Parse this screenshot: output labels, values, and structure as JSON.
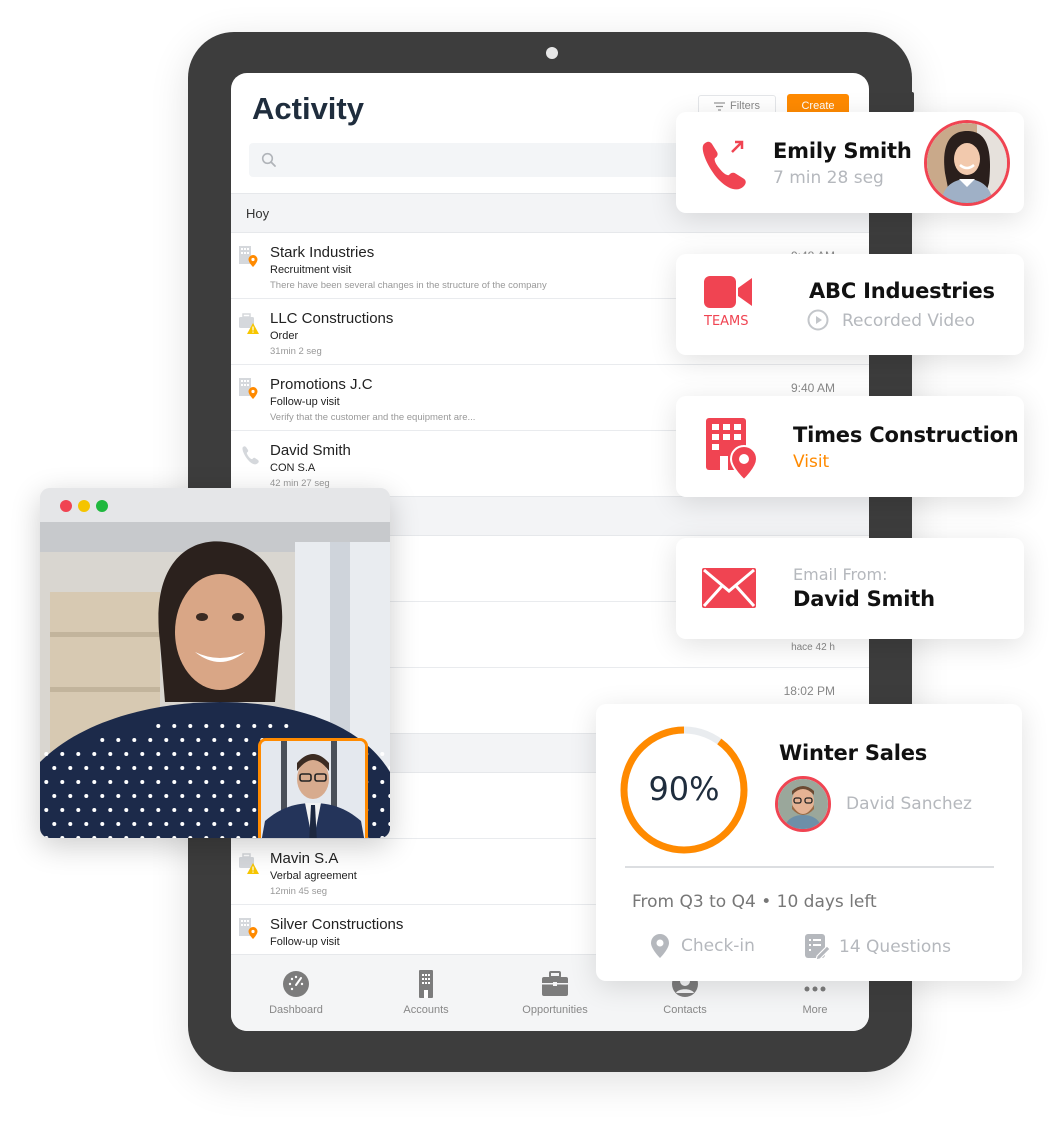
{
  "app": {
    "title": "Activity",
    "filters_label": "Filters",
    "create_label": "Create",
    "search": {
      "placeholder": "",
      "value": ""
    }
  },
  "colors": {
    "accent": "#ff8a00",
    "red": "#f04452",
    "tablet": "#3d3d3d",
    "title": "#1f2d3d"
  },
  "sections": [
    {
      "label": "Hoy"
    },
    {
      "label": ""
    },
    {
      "label": ""
    }
  ],
  "activities": [
    {
      "icon": "building-location-icon",
      "title": "Stark Industries",
      "subtitle": "Recruitment visit",
      "meta": "There have been several changes in the structure of the company",
      "time": "9:48 AM"
    },
    {
      "icon": "briefcase-warning-icon",
      "title": "LLC Constructions",
      "subtitle": "Order",
      "meta": "31min 2 seg",
      "time": ""
    },
    {
      "icon": "building-location-icon",
      "title": "Promotions J.C",
      "subtitle": "Follow-up visit",
      "meta": "Verify that the customer and the equipment are...",
      "time": "9:40 AM"
    },
    {
      "icon": "phone-icon",
      "title": "David Smith",
      "subtitle": "CON S.A",
      "meta": "42 min 27 seg",
      "time": ""
    },
    {
      "icon": "",
      "title": "",
      "subtitle": "",
      "meta": "",
      "time": ""
    },
    {
      "icon": "",
      "title": "",
      "subtitle": "",
      "meta": "",
      "time": "hace 42 h"
    },
    {
      "icon": "",
      "title": "",
      "subtitle": "",
      "meta": "",
      "time": "18:02 PM"
    },
    {
      "icon": "",
      "title": "",
      "subtitle": "",
      "meta": "",
      "time": ""
    },
    {
      "icon": "briefcase-warning-icon",
      "title": "Mavin S.A",
      "subtitle": "Verbal agreement",
      "meta": "12min 45 seg",
      "time": ""
    },
    {
      "icon": "building-location-icon",
      "title": "Silver Constructions",
      "subtitle": "Follow-up visit",
      "meta": "",
      "time": ""
    }
  ],
  "bottom_nav": [
    {
      "label": "Dashboard",
      "icon": "dashboard-gauge-icon"
    },
    {
      "label": "Accounts",
      "icon": "building-icon"
    },
    {
      "label": "Opportunities",
      "icon": "briefcase-icon"
    },
    {
      "label": "Contacts",
      "icon": "contact-person-icon"
    },
    {
      "label": "More",
      "icon": "more-dots-icon"
    }
  ],
  "cards": {
    "call": {
      "name": "Emily Smith",
      "duration": "7 min 28 seg",
      "icon": "outgoing-call-icon"
    },
    "teams": {
      "badge": "TEAMS",
      "company": "ABC Induestries",
      "status": "Recorded Video"
    },
    "visit": {
      "company": "Times Construction",
      "type": "Visit"
    },
    "email": {
      "label": "Email From:",
      "sender": "David Smith"
    },
    "goal": {
      "progress_percent": 90,
      "progress_label": "90%",
      "title": "Winter Sales",
      "owner": "David Sanchez",
      "period": "From Q3 to Q4 • 10 days left",
      "checkin_label": "Check-in",
      "questions_label": "14 Questions"
    }
  },
  "video_call": {
    "window_controls": [
      "close",
      "minimize",
      "maximize"
    ]
  }
}
